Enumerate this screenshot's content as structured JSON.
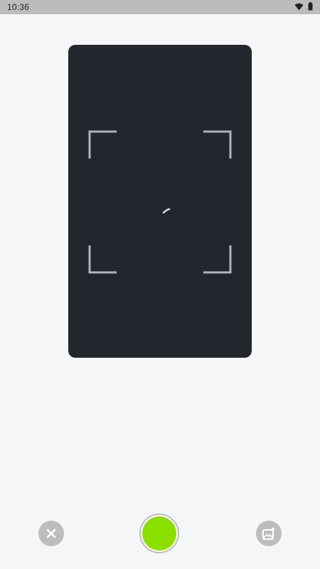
{
  "status_bar": {
    "time": "10:36",
    "icons": [
      "wifi-icon",
      "battery-icon"
    ]
  },
  "camera": {
    "frame_icon": "scan-corners",
    "loading_icon": "spinner-icon",
    "background_color": "#23272d",
    "guide_color": "#b0b3b7"
  },
  "controls": {
    "close_icon": "close-icon",
    "shutter_color": "#8be000",
    "gallery_icon": "image-sparkle-icon",
    "button_color": "#bdbdbd"
  }
}
